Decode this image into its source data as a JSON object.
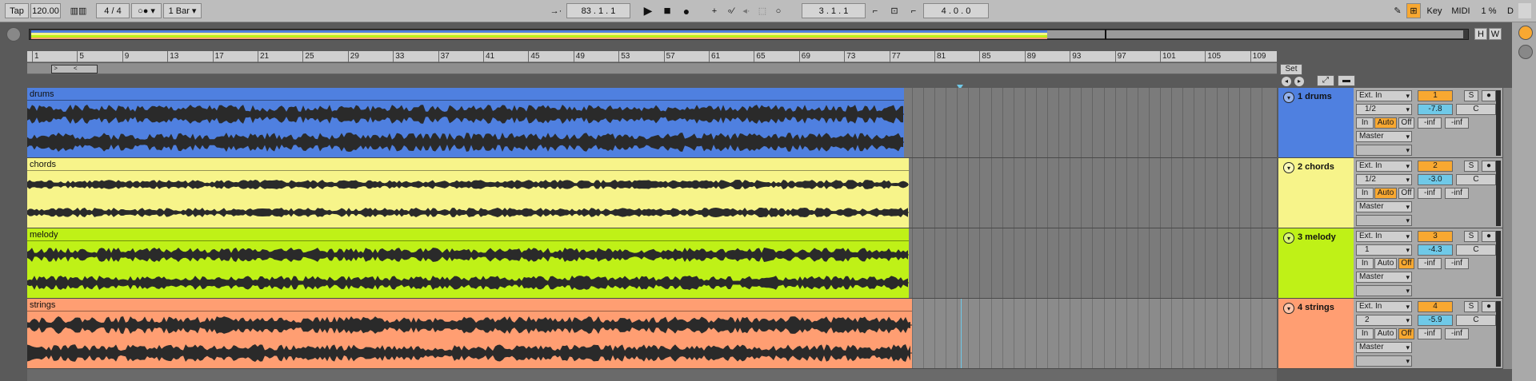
{
  "transport": {
    "tap": "Tap",
    "tempo": "120.00",
    "time_sig": "4 / 4",
    "quantize": "1 Bar",
    "position": "83 .  1 .  1",
    "loop_start": "3 .  1 .  1",
    "loop_length": "4 .  0 .  0",
    "key": "Key",
    "midi": "MIDI",
    "cpu": "1 %",
    "d": "D"
  },
  "overview": {
    "h": "H",
    "w": "W"
  },
  "ruler": [
    "1",
    "5",
    "9",
    "13",
    "17",
    "21",
    "25",
    "29",
    "33",
    "37",
    "41",
    "45",
    "49",
    "53",
    "57",
    "61",
    "65",
    "69",
    "73",
    "77",
    "81",
    "85",
    "89",
    "93",
    "97",
    "101",
    "105",
    "109"
  ],
  "set_button": "Set",
  "colors": {
    "drums": "#4f80e0",
    "chords": "#f7f48a",
    "melody": "#bff117",
    "strings": "#ff9e72",
    "arm_orange": "#f8a831",
    "volume_blue": "#6fc9e8"
  },
  "tracks": [
    {
      "clip": "drums",
      "name": "1 drums",
      "input": "Ext. In",
      "channel": "1/2",
      "monitor": [
        "In",
        "Auto",
        "Off"
      ],
      "monitor_on": "Auto",
      "output": "Master",
      "number": "1",
      "solo": "S",
      "volume": "-7.8",
      "pan": "C",
      "meter_l": "-inf",
      "meter_r": "-inf"
    },
    {
      "clip": "chords",
      "name": "2 chords",
      "input": "Ext. In",
      "channel": "1/2",
      "monitor": [
        "In",
        "Auto",
        "Off"
      ],
      "monitor_on": "Auto",
      "output": "Master",
      "number": "2",
      "solo": "S",
      "volume": "-3.0",
      "pan": "C",
      "meter_l": "-inf",
      "meter_r": "-inf"
    },
    {
      "clip": "melody",
      "name": "3 melody",
      "input": "Ext. In",
      "channel": "1",
      "monitor": [
        "In",
        "Auto",
        "Off"
      ],
      "monitor_on": "Off",
      "output": "Master",
      "number": "3",
      "solo": "S",
      "volume": "-4.3",
      "pan": "C",
      "meter_l": "-inf",
      "meter_r": "-inf"
    },
    {
      "clip": "strings",
      "name": "4 strings",
      "input": "Ext. In",
      "channel": "2",
      "monitor": [
        "In",
        "Auto",
        "Off"
      ],
      "monitor_on": "Off",
      "output": "Master",
      "number": "4",
      "solo": "S",
      "volume": "-5.9",
      "pan": "C",
      "meter_l": "-inf",
      "meter_r": "-inf"
    }
  ]
}
